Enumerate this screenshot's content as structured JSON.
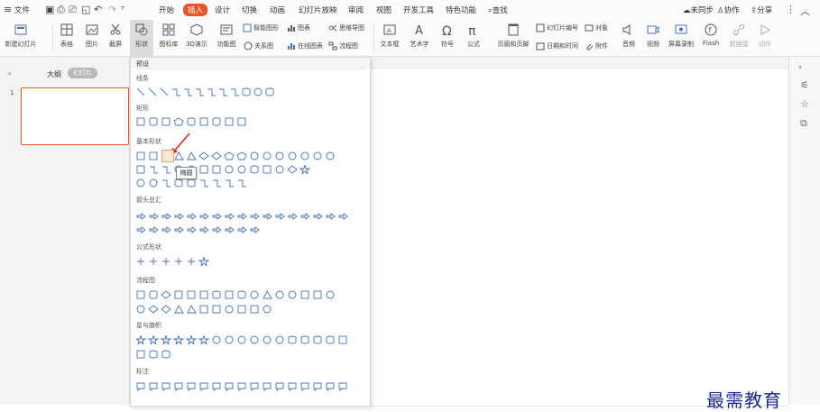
{
  "menubar": {
    "file": "文件",
    "tabs": [
      "开始",
      "插入",
      "设计",
      "切换",
      "动画",
      "幻灯片放映",
      "审阅",
      "视图",
      "开发工具",
      "特色功能"
    ],
    "active_tab": "插入",
    "search": "查找",
    "sync": "未同步",
    "collab": "协作",
    "share": "分享"
  },
  "ribbon": {
    "new_slide": "新建幻灯片",
    "table": "表格",
    "picture": "图片",
    "screenshot": "截屏",
    "shape": "形状",
    "icon_lib": "图标库",
    "3d": "3D演示",
    "func_chart": "功能图",
    "smart_shape": "智能图形",
    "chart": "图表",
    "mind_map": "思维导图",
    "relation": "关系图",
    "online_chart": "在线图表",
    "flowchart": "流程图",
    "textbox": "文本框",
    "art_text": "艺术字",
    "symbol": "符号",
    "formula": "公式",
    "header_footer": "页眉和页脚",
    "slide_number": "幻灯片编号",
    "object": "对象",
    "datetime": "日期和时间",
    "attachment": "附件",
    "audio": "音频",
    "video": "视频",
    "screen_rec": "屏幕录制",
    "flash": "Flash",
    "hyperlink": "超链接",
    "action": "动作"
  },
  "leftpanel": {
    "outline": "大纲",
    "slides": "幻灯片",
    "slide_number": "1"
  },
  "dropdown": {
    "preset": "预设",
    "categories": [
      "线条",
      "矩形",
      "基本形状",
      "箭头总汇",
      "公式形状",
      "流程图",
      "星与旗帜",
      "标注"
    ]
  },
  "tooltip": "椭圆",
  "watermark": "最需教育",
  "colors": {
    "accent": "#e8542a",
    "shape_stroke": "#4a72b0"
  }
}
